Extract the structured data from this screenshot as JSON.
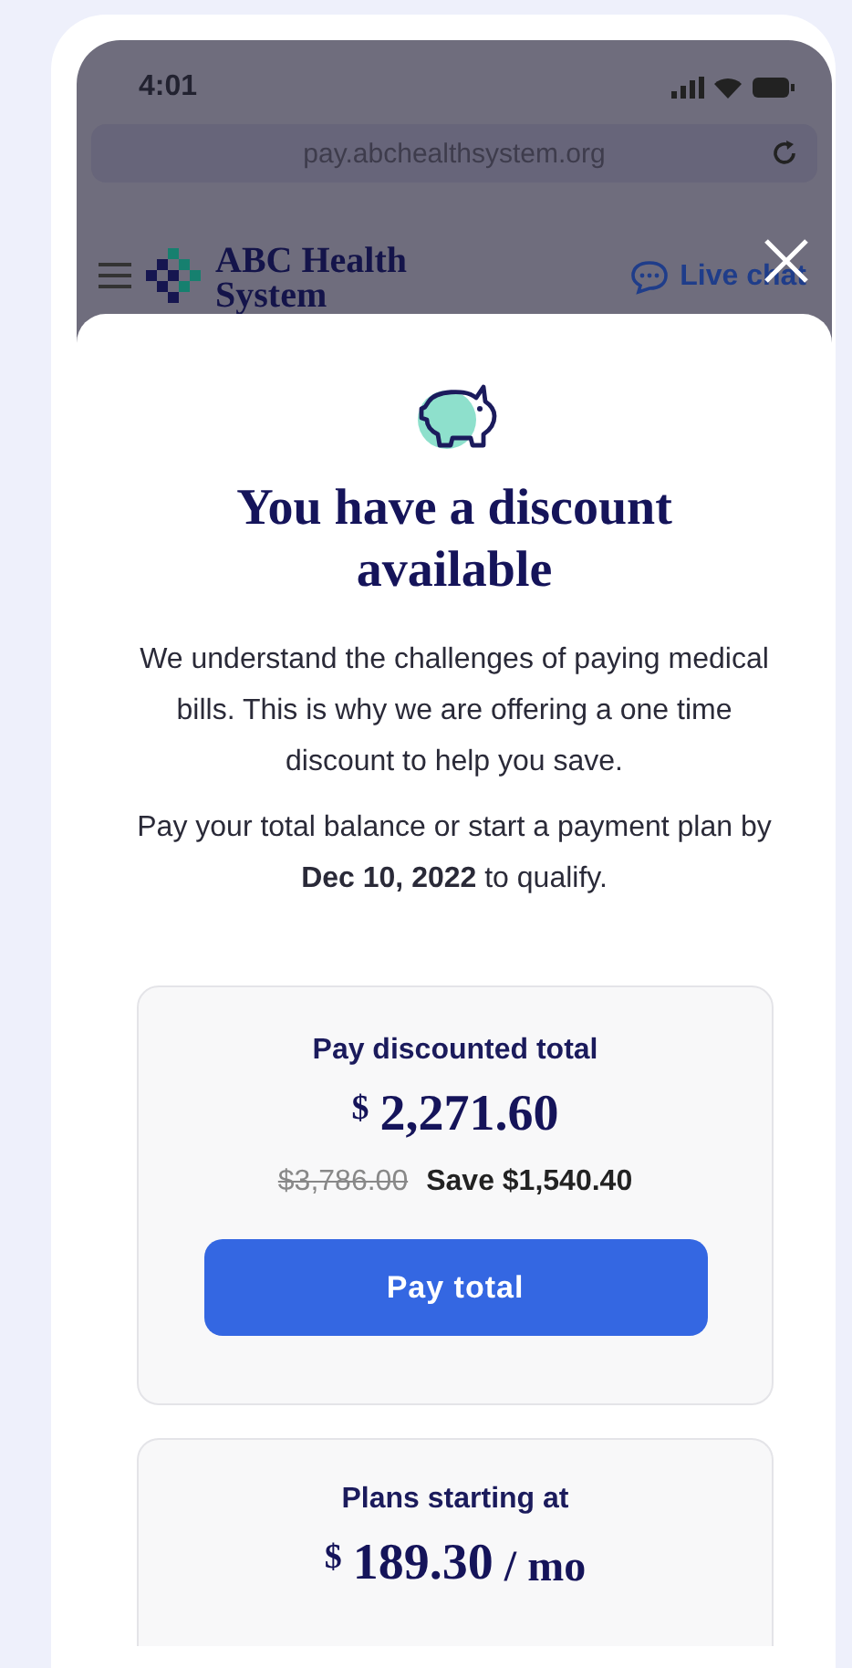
{
  "status_bar": {
    "time": "4:01"
  },
  "browser": {
    "url": "pay.abchealthsystem.org"
  },
  "site_header": {
    "logo_lines": [
      "ABC Health",
      "System"
    ],
    "live_chat": "Live chat"
  },
  "modal": {
    "title": "You have a discount available",
    "paragraphs": [
      "We understand the challenges of paying medical bills. This is why we are offering a one time discount to help you save.",
      "Pay your total balance or start a payment plan by **Dec 10, 2022** to qualify."
    ],
    "offer": {
      "heading": "Pay discounted total",
      "currency": "$",
      "amount": "2,271.60",
      "original_price": "$3,786.00",
      "savings": "Save $1,540.40",
      "button": "Pay total"
    },
    "plans": {
      "heading": "Plans starting at",
      "currency": "$",
      "amount": "189.30",
      "unit": "/ mo"
    }
  }
}
